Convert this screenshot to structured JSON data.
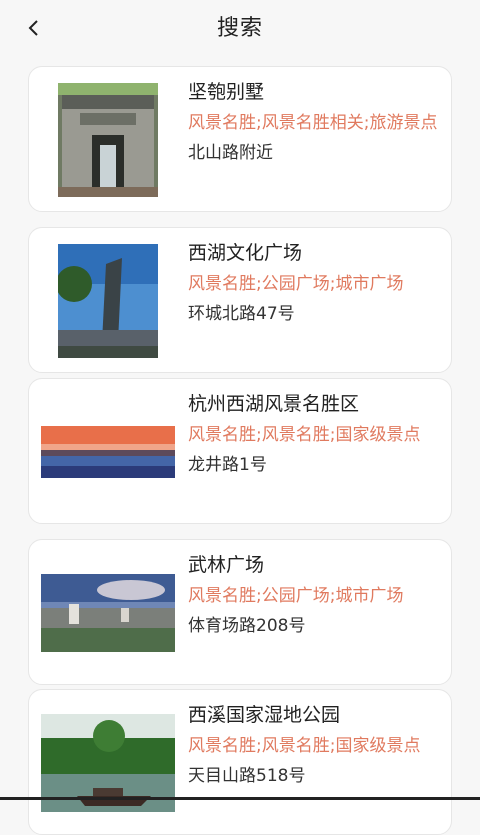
{
  "header": {
    "title": "搜索"
  },
  "items": [
    {
      "name": "坚匏别墅",
      "category": "风景名胜;风景名胜相关;旅游景点",
      "address": "北山路附近"
    },
    {
      "name": "西湖文化广场",
      "category": "风景名胜;公园广场;城市广场",
      "address": "环城北路47号"
    },
    {
      "name": "杭州西湖风景名胜区",
      "category": "风景名胜;风景名胜;国家级景点",
      "address": "龙井路1号"
    },
    {
      "name": "武林广场",
      "category": "风景名胜;公园广场;城市广场",
      "address": "体育场路208号"
    },
    {
      "name": "西溪国家湿地公园",
      "category": "风景名胜;风景名胜;国家级景点",
      "address": "天目山路518号"
    }
  ]
}
